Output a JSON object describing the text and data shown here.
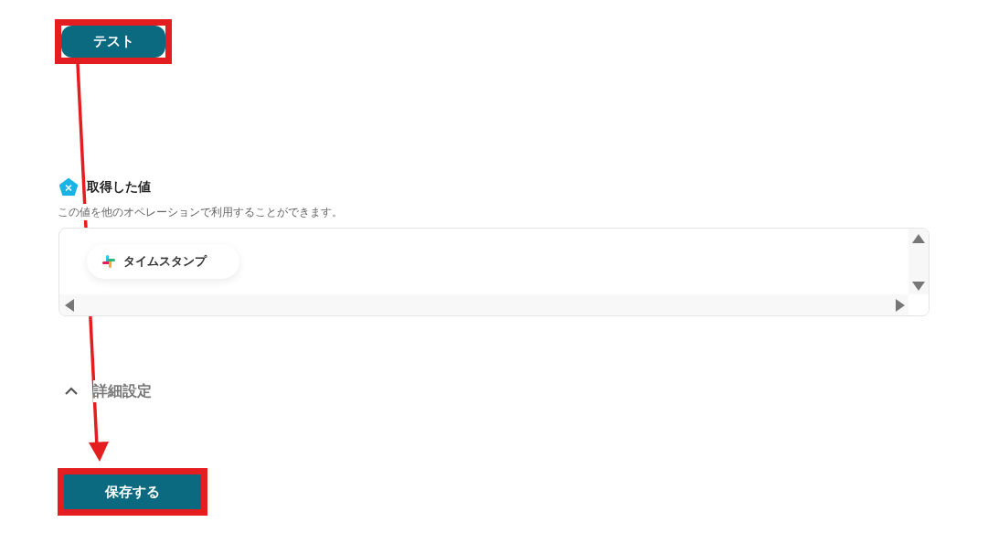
{
  "test_button": {
    "label": "テスト",
    "highlighted": true
  },
  "output_values": {
    "title": "取得した値",
    "description": "この値を他のオペレーションで利用することができます。",
    "items": [
      {
        "label": "タイムスタンプ"
      }
    ]
  },
  "advanced_settings": {
    "label": "詳細設定",
    "expanded": true
  },
  "save_button": {
    "label": "保存する",
    "highlighted": true
  }
}
